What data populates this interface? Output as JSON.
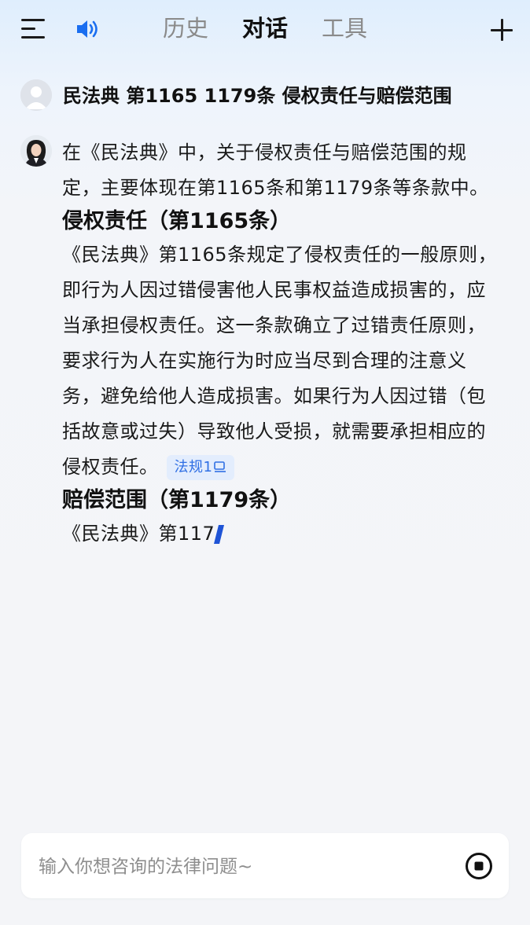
{
  "header": {
    "menu_icon": "hamburger-menu-icon",
    "speaker_icon": "speaker-icon",
    "tabs": [
      {
        "label": "历史",
        "active": false
      },
      {
        "label": "对话",
        "active": true
      },
      {
        "label": "工具",
        "active": false
      }
    ],
    "add_icon": "plus-icon"
  },
  "conversation": {
    "user_question": "民法典 第1165 1179条 侵权责任与赔偿范围",
    "answer": {
      "intro": "在《民法典》中，关于侵权责任与赔偿范围的规定，主要体现在第1165条和第1179条等条款中。",
      "section1_heading": "侵权责任（第1165条）",
      "section1_body": "《民法典》第1165条规定了侵权责任的一般原则，即行为人因过错侵害他人民事权益造成损害的，应当承担侵权责任。这一条款确立了过错责任原则，要求行为人在实施行为时应当尽到合理的注意义务，避免给他人造成损害。如果行为人因过错（包括故意或过失）导致他人受损，就需要承担相应的侵权责任。",
      "reference_badge": "法规1",
      "section2_heading": "赔偿范围（第1179条）",
      "section2_body": "《民法典》第117"
    }
  },
  "input": {
    "placeholder": "输入你想咨询的法律问题~",
    "value": ""
  },
  "colors": {
    "accent": "#2f6fe4",
    "cursor": "#1f54d6",
    "badge_bg": "#e3edfd"
  }
}
